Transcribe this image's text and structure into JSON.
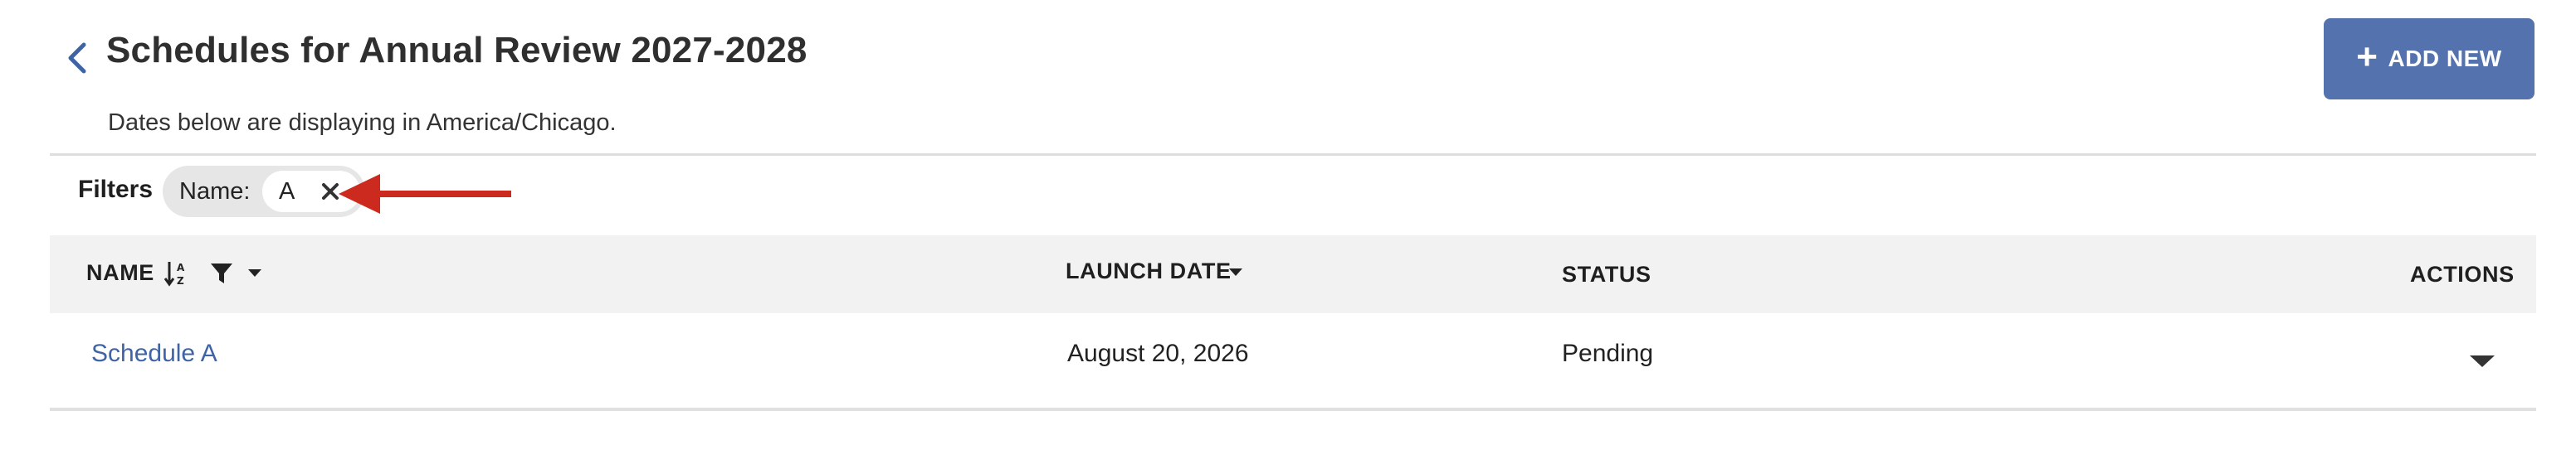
{
  "header": {
    "title": "Schedules for Annual Review 2027-2028",
    "subtitle": "Dates below are displaying in America/Chicago.",
    "add_new_label": "ADD NEW",
    "accent_color": "#5472ad"
  },
  "filters": {
    "label": "Filters",
    "chips": [
      {
        "key": "Name:",
        "value": "A"
      }
    ]
  },
  "annotation": {
    "arrow_color": "#cc2a1e"
  },
  "table": {
    "columns": [
      {
        "label": "NAME"
      },
      {
        "label": "LAUNCH DATE"
      },
      {
        "label": "STATUS"
      },
      {
        "label": "ACTIONS"
      }
    ],
    "rows": [
      {
        "name": "Schedule A",
        "launch_date": "August 20, 2026",
        "status": "Pending"
      }
    ]
  }
}
